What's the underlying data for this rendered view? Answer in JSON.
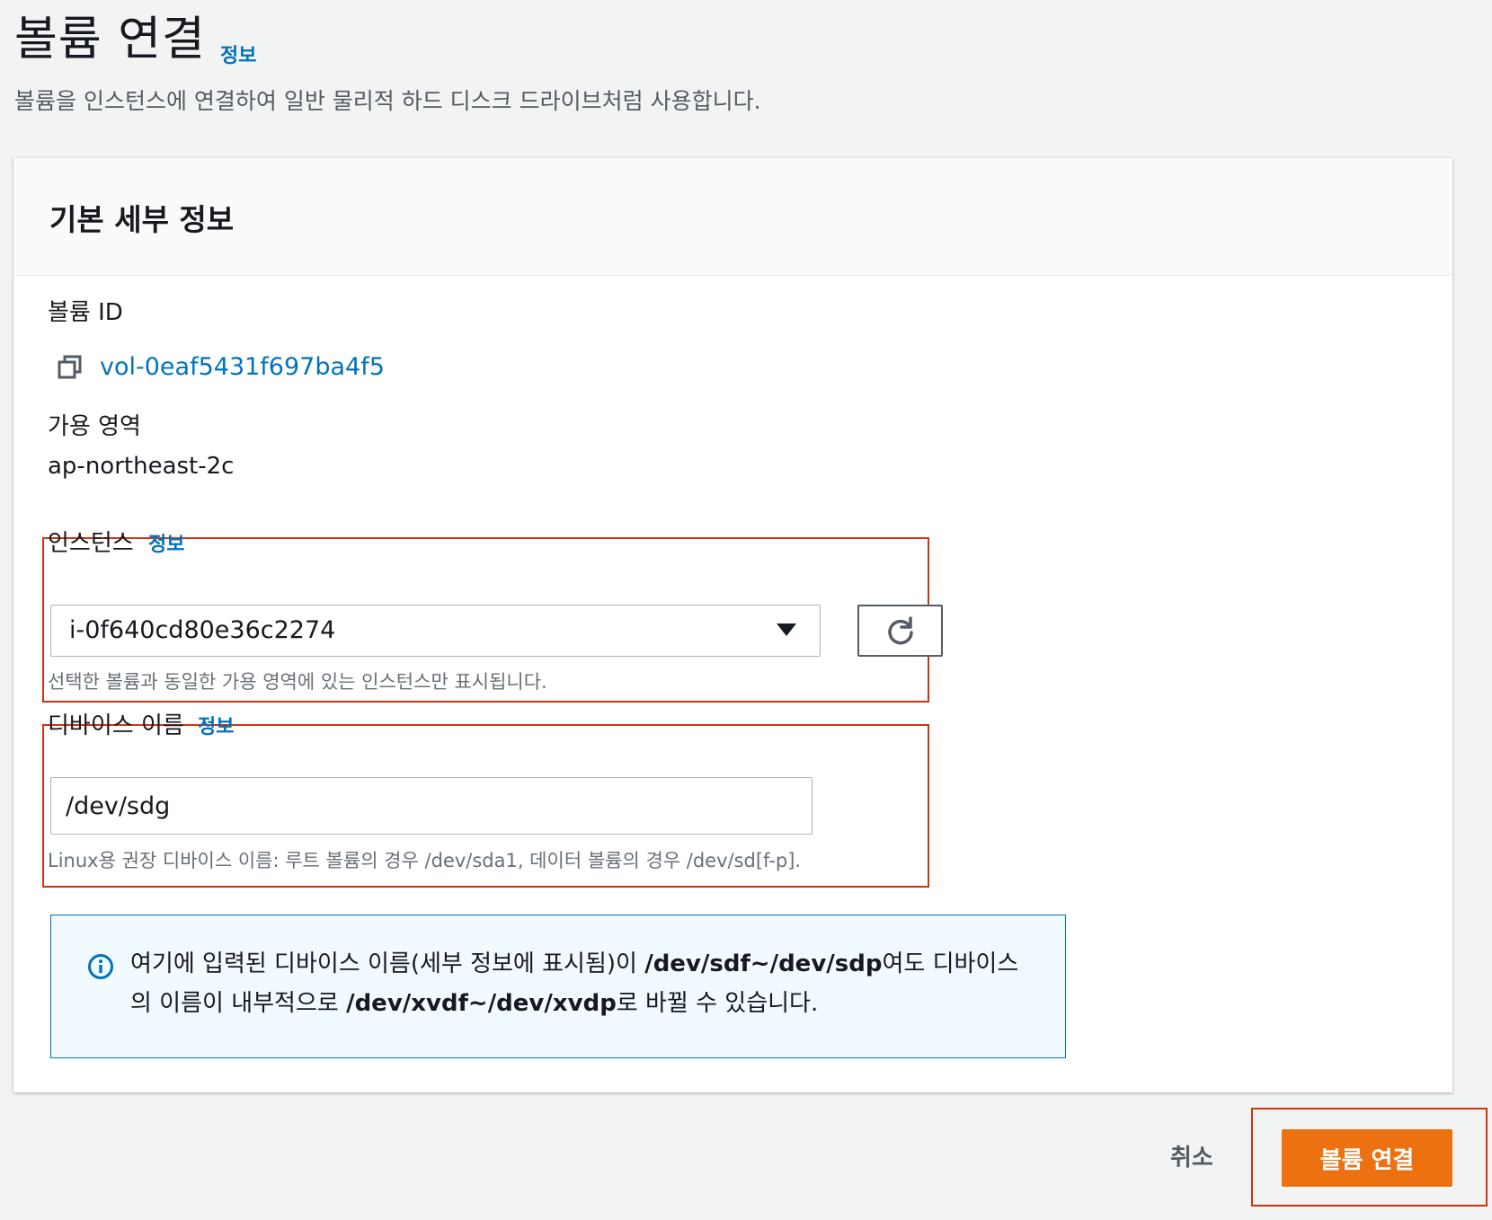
{
  "header": {
    "title": "볼륨 연결",
    "info_link": "정보",
    "description": "볼륨을 인스턴스에 연결하여 일반 물리적 하드 디스크 드라이브처럼 사용합니다."
  },
  "section": {
    "title": "기본 세부 정보",
    "volume_id": {
      "label": "볼륨 ID",
      "value": "vol-0eaf5431f697ba4f5",
      "icon": "copy-icon"
    },
    "availability_zone": {
      "label": "가용 영역",
      "value": "ap-northeast-2c"
    },
    "instance": {
      "label": "인스턴스",
      "info_link": "정보",
      "selected": "i-0f640cd80e36c2274",
      "hint": "선택한 볼륨과 동일한 가용 영역에 있는 인스턴스만 표시됩니다.",
      "refresh_icon": "refresh-icon"
    },
    "device_name": {
      "label": "디바이스 이름",
      "info_link": "정보",
      "value": "/dev/sdg",
      "hint": "Linux용 권장 디바이스 이름: 루트 볼륨의 경우 /dev/sda1, 데이터 볼륨의 경우 /dev/sd[f-p]."
    },
    "alert": {
      "icon": "info-icon",
      "text_1": "여기에 입력된 디바이스 이름(세부 정보에 표시됨)이 ",
      "bold_1": "/dev/sdf~/dev/sdp",
      "text_2": "여도 디바이스의 이름이 내부적으로 ",
      "bold_2": "/dev/xvdf~/dev/xvdp",
      "text_3": "로 바뀔 수 있습니다."
    }
  },
  "footer": {
    "cancel_label": "취소",
    "submit_label": "볼륨 연결"
  },
  "colors": {
    "link": "#0073bb",
    "primary": "#ec7211",
    "highlight": "#d13212",
    "alert_bg": "#f1faff"
  }
}
